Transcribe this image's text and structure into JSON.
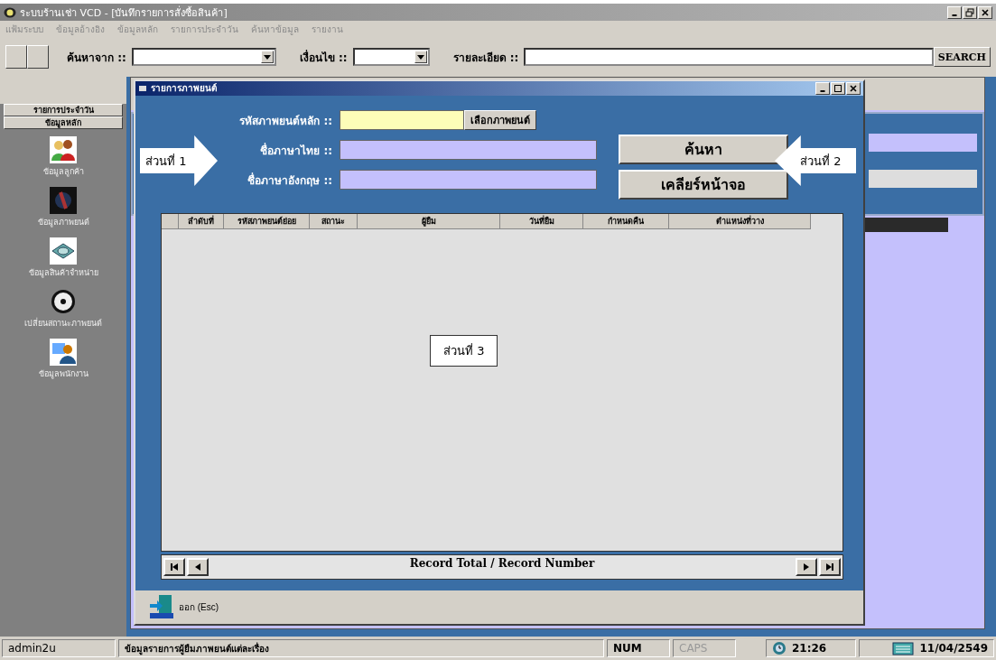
{
  "window": {
    "title": "ระบบร้านเช่า VCD - [บันทึกรายการสั่งซื้อสินค้า]"
  },
  "menu": [
    "แฟ้มระบบ",
    "ข้อมูลอ้างอิง",
    "ข้อมูลหลัก",
    "รายการประจำวัน",
    "ค้นหาข้อมูล",
    "รายงาน"
  ],
  "toolbar": {
    "search_from_label": "ค้นหาจาก ::",
    "condition_label": "เงื่อนไข ::",
    "detail_label": "รายละเอียด ::",
    "search_button": "SEARCH"
  },
  "sidebar": {
    "tabs": [
      "รายการประจำวัน",
      "ข้อมูลหลัก"
    ],
    "items": [
      {
        "label": "ข้อมูลลูกค้า",
        "kind": "people"
      },
      {
        "label": "ข้อมูลภาพยนต์",
        "kind": "film"
      },
      {
        "label": "ข้อมูลสินค้าจำหน่าย",
        "kind": "product"
      },
      {
        "label": "เปลี่ยนสถานะภาพยนต์",
        "kind": "disc"
      },
      {
        "label": "ข้อมูลพนักงาน",
        "kind": "staff"
      }
    ]
  },
  "dialog": {
    "title": "รายการภาพยนต์",
    "fields": [
      {
        "label": "รหัสภาพยนต์หลัก ::",
        "kind": "code",
        "button": "เลือกภาพยนต์"
      },
      {
        "label": "ชื่อภาษาไทย ::",
        "kind": "name"
      },
      {
        "label": "ชื่อภาษาอังกฤษ ::",
        "kind": "name"
      }
    ],
    "buttons": [
      "ค้นหา",
      "เคลียร์หน้าจอ"
    ],
    "callouts": [
      {
        "label": "ส่วนที่ 1",
        "kind": "right"
      },
      {
        "label": "ส่วนที่ 2",
        "kind": "left"
      },
      {
        "label": "ส่วนที่ 3",
        "kind": "box"
      }
    ],
    "table": {
      "columns": [
        "ลำดับที่",
        "รหัสภาพยนต์ย่อย",
        "สถานะ",
        "ผู้ยืม",
        "วันที่ยืม",
        "กำหนดคืน",
        "ตำแหน่งที่วาง"
      ]
    },
    "navigator": "Record Total / Record Number",
    "exit_button": "ออก (Esc)"
  },
  "status_bar": {
    "user": "admin2u",
    "message": "ข้อมูลรายการผู้ยืมภาพยนต์แต่ละเรื่อง",
    "keys": [
      {
        "label": "NUM",
        "on": true
      },
      {
        "label": "CAPS",
        "on": false
      }
    ],
    "time": "21:26",
    "date": "11/04/2549"
  }
}
